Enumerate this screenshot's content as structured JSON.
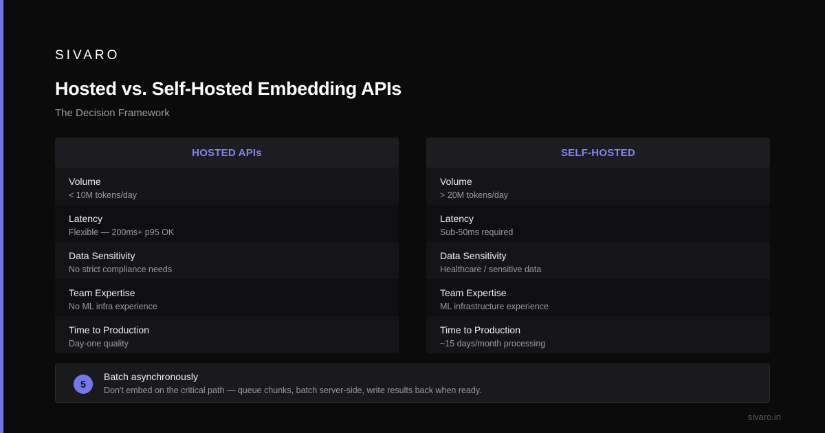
{
  "brand": "SIVARO",
  "title": "Hosted vs. Self-Hosted Embedding APIs",
  "subtitle": "The Decision Framework",
  "accent_color": "#7f85f2",
  "hosted": {
    "heading": "HOSTED APIs",
    "rows": [
      {
        "label": "Volume",
        "value": "< 10M tokens/day"
      },
      {
        "label": "Latency",
        "value": "Flexible — 200ms+ p95 OK"
      },
      {
        "label": "Data Sensitivity",
        "value": "No strict compliance needs"
      },
      {
        "label": "Team Expertise",
        "value": "No ML infra experience"
      },
      {
        "label": "Time to Production",
        "value": "Day-one quality"
      }
    ]
  },
  "self_hosted": {
    "heading": "SELF-HOSTED",
    "rows": [
      {
        "label": "Volume",
        "value": "> 20M tokens/day"
      },
      {
        "label": "Latency",
        "value": "Sub-50ms required"
      },
      {
        "label": "Data Sensitivity",
        "value": "Healthcare / sensitive data"
      },
      {
        "label": "Team Expertise",
        "value": "ML infrastructure experience"
      },
      {
        "label": "Time to Production",
        "value": "~15 days/month processing"
      }
    ]
  },
  "tip": {
    "number": "5",
    "title": "Batch asynchronously",
    "description": "Don't embed on the critical path — queue chunks, batch server-side, write results back when ready."
  },
  "footer": "sivaro.in"
}
